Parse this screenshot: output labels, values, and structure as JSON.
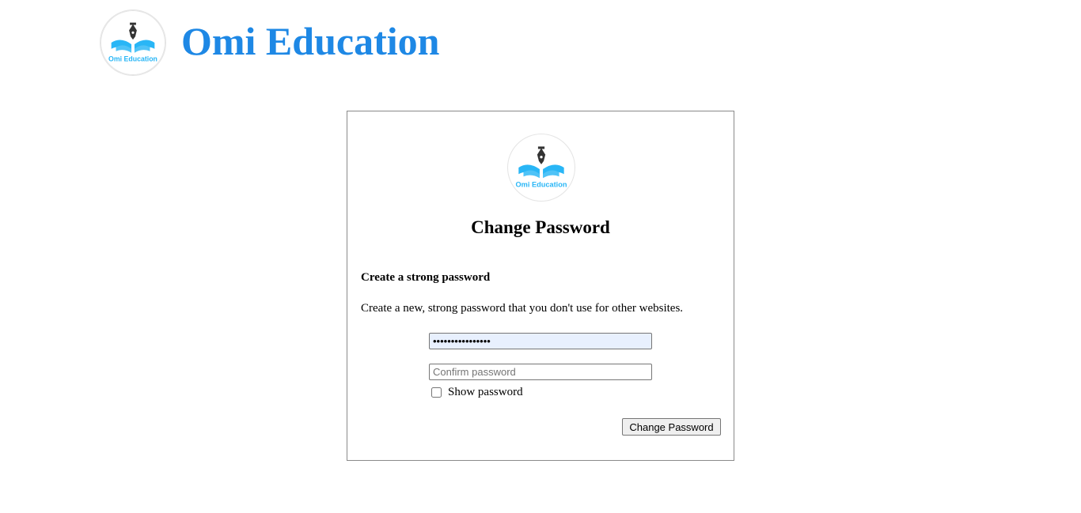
{
  "header": {
    "logo_icon": "omi-education-logo-icon",
    "logo_text": "Omi Education",
    "title": "Omi Education",
    "title_color": "#1e88e5"
  },
  "card": {
    "logo_icon": "omi-education-logo-icon",
    "logo_text": "Omi Education",
    "title": "Change Password",
    "subheading": "Create a strong password",
    "description": "Create a new, strong password that you don't use for other websites.",
    "new_password": {
      "value": "••••••••••••••••",
      "background": "#e8f0fe"
    },
    "confirm_password": {
      "value": "",
      "placeholder": "Confirm password"
    },
    "show_password": {
      "label": "Show password",
      "checked": false
    },
    "submit_label": "Change Password"
  },
  "brand_colors": {
    "primary_blue": "#1e88e5",
    "logo_cyan": "#29b6f6",
    "logo_pen": "#333333"
  }
}
